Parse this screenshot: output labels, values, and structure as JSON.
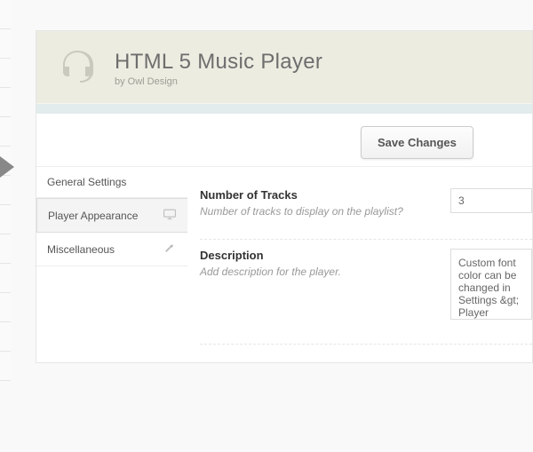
{
  "header": {
    "title": "HTML 5 Music Player",
    "byline": "by Owl Design"
  },
  "toolbar": {
    "save_label": "Save Changes"
  },
  "sidebar": {
    "items": [
      {
        "label": "General Settings"
      },
      {
        "label": "Player Appearance"
      },
      {
        "label": "Miscellaneous"
      }
    ]
  },
  "fields": {
    "tracks": {
      "title": "Number of Tracks",
      "help": "Number of tracks to display on the playlist?",
      "value": "3"
    },
    "description": {
      "title": "Description",
      "help": "Add description for the player.",
      "value": "Custom font color can be changed in Settings &gt; Player"
    }
  }
}
